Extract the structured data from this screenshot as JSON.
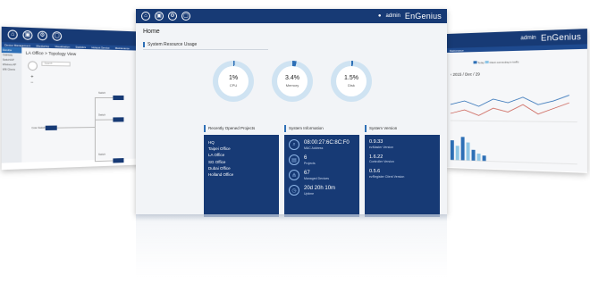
{
  "left_window": {
    "nav": [
      "Device Management",
      "Monitoring",
      "Visualization",
      "Statistics",
      "Hotspot Service",
      "Maintenance"
    ],
    "sidebar_header": "Device",
    "sidebar_items": [
      "Gateway",
      "Switch/AP",
      "Wireless AP",
      "Wifi Clients"
    ],
    "title": "LA Office > Topology View",
    "search_placeholder": "Search",
    "nodes": [
      {
        "label": "Core Switch"
      },
      {
        "label": "Switch"
      },
      {
        "label": "Switch"
      },
      {
        "label": "Switch"
      },
      {
        "label": "AP"
      }
    ]
  },
  "main_window": {
    "user": "admin",
    "brand": "EnGenius",
    "title": "Home",
    "resource_title": "System Resource Usage",
    "resources": [
      {
        "label": "CPU",
        "value": "1%",
        "fraction": 0.01
      },
      {
        "label": "Memory",
        "value": "3.4%",
        "fraction": 0.034
      },
      {
        "label": "Disk",
        "value": "1.5%",
        "fraction": 0.015
      }
    ],
    "projects_title": "Recently Opened Projects",
    "projects": [
      "HQ",
      "Taipei Office",
      "LA Office",
      "SG Office",
      "Dubai Office",
      "Holland Office"
    ],
    "info_title": "System Information",
    "info": [
      {
        "value": "08:00:27:6C:8C:F0",
        "label": "MAC Address",
        "icon": "mac-icon"
      },
      {
        "value": "6",
        "label": "Projects",
        "icon": "projects-icon"
      },
      {
        "value": "67",
        "label": "Managed Devices",
        "icon": "devices-icon"
      },
      {
        "value": "20d 20h 10m",
        "label": "Uptime",
        "icon": "uptime-icon"
      }
    ],
    "version_title": "System Version",
    "versions": [
      {
        "value": "0.9.33",
        "label": "ezMaster Version"
      },
      {
        "value": "1.6.22",
        "label": "Controller Version"
      },
      {
        "value": "0.5.6",
        "label": "ezRegister Client Version"
      }
    ]
  },
  "right_window": {
    "user": "admin",
    "brand": "EnGenius",
    "nav": "Maintenance",
    "date": "2015 / Dec / 29",
    "legend": [
      "Today",
      "Client connecting in traffic"
    ]
  },
  "colors": {
    "navy": "#173a75",
    "accent": "#2d6fb6",
    "donut_track": "#cfe3f2",
    "donut_fill": "#2d6fb6"
  }
}
